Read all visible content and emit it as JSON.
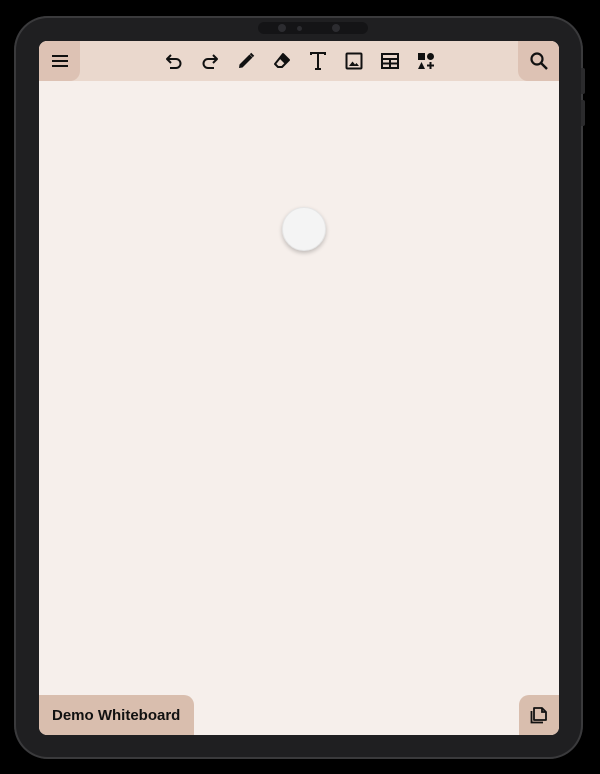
{
  "toolbar": {
    "menu_icon": "menu-icon",
    "tools": [
      "undo-icon",
      "redo-icon",
      "pen-icon",
      "eraser-icon",
      "text-icon",
      "image-icon",
      "table-icon",
      "shapes-add-icon"
    ],
    "search_icon": "search-icon"
  },
  "board": {
    "name": "Demo Whiteboard",
    "pages_icon": "pages-icon"
  },
  "colors": {
    "canvas": "#f6efeb",
    "toolbar": "#ead8cd",
    "accent": "#d9beae",
    "device": "#1f1f21"
  }
}
